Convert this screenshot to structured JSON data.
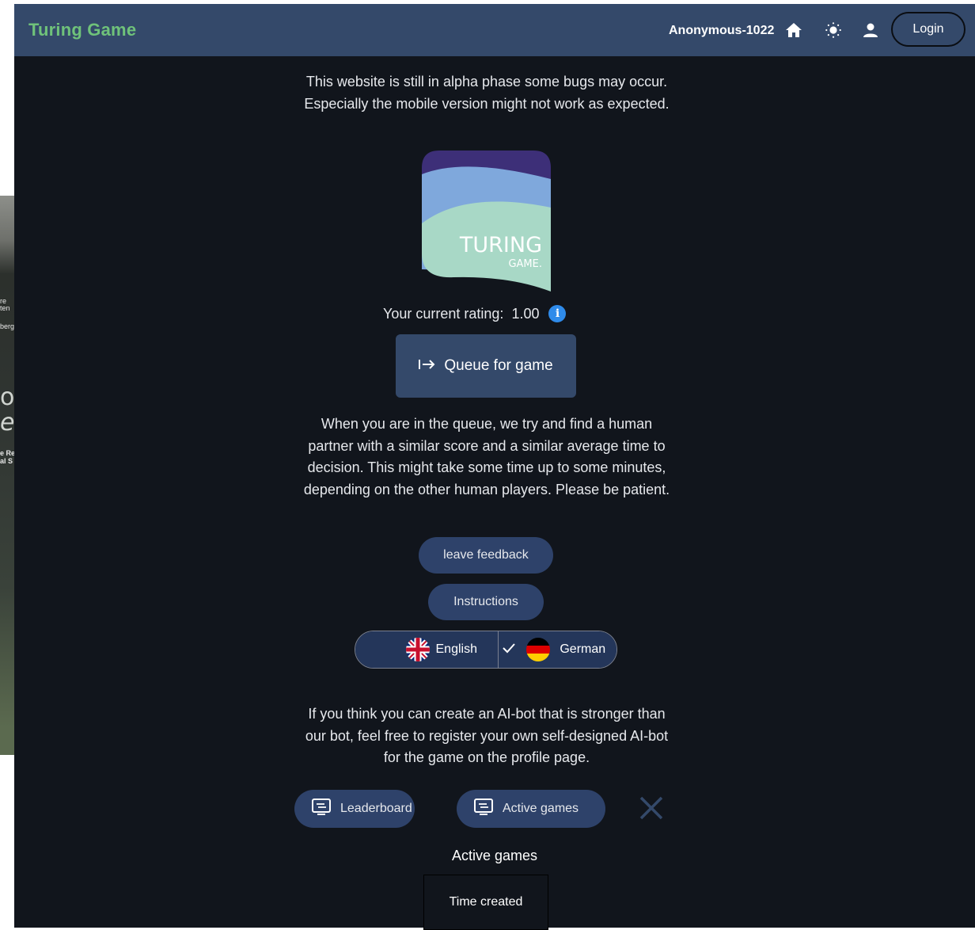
{
  "header": {
    "brand": "Turing Game",
    "username": "Anonymous-1022",
    "login_label": "Login",
    "icons": [
      "home-icon",
      "sun-icon",
      "person-icon"
    ]
  },
  "notice": "This website is still in alpha phase some bugs may occur. Especially the mobile version might not work as expected.",
  "logo": {
    "line1": "TURING",
    "line2": "GAME."
  },
  "rating": {
    "label": "Your current rating:",
    "value": "1.00"
  },
  "queue_button": {
    "label": "Queue for game",
    "icon": "arrow-to-right-icon"
  },
  "queue_text": "When you are in the queue, we try and find a human partner with a similar score and a similar average time to decision. This might take some time up to some minutes, depending on the other human players. Please be patient.",
  "buttons": {
    "feedback": "leave feedback",
    "instructions": "Instructions"
  },
  "language": {
    "options": [
      {
        "label": "English",
        "flag": "uk-flag-icon",
        "selected": false
      },
      {
        "label": "German",
        "flag": "germany-flag-icon",
        "selected": true
      }
    ]
  },
  "bot_text": "If you think you can create an AI-bot that is stronger than our bot, feel free to register your own self-designed AI-bot for the game on the profile page.",
  "nav": {
    "leaderboard": "Leaderboard",
    "active_games": "Active games"
  },
  "active_games": {
    "title": "Active games",
    "columns": [
      "Time created"
    ]
  },
  "background_fragments": [
    "re",
    "ten",
    "berg",
    "o\\",
    "el",
    "e Re",
    "al S"
  ],
  "colors": {
    "header": "#34496a",
    "brand": "#6fc27a",
    "background": "#11151c",
    "button": "#2e426a",
    "info": "#2f8bea"
  }
}
